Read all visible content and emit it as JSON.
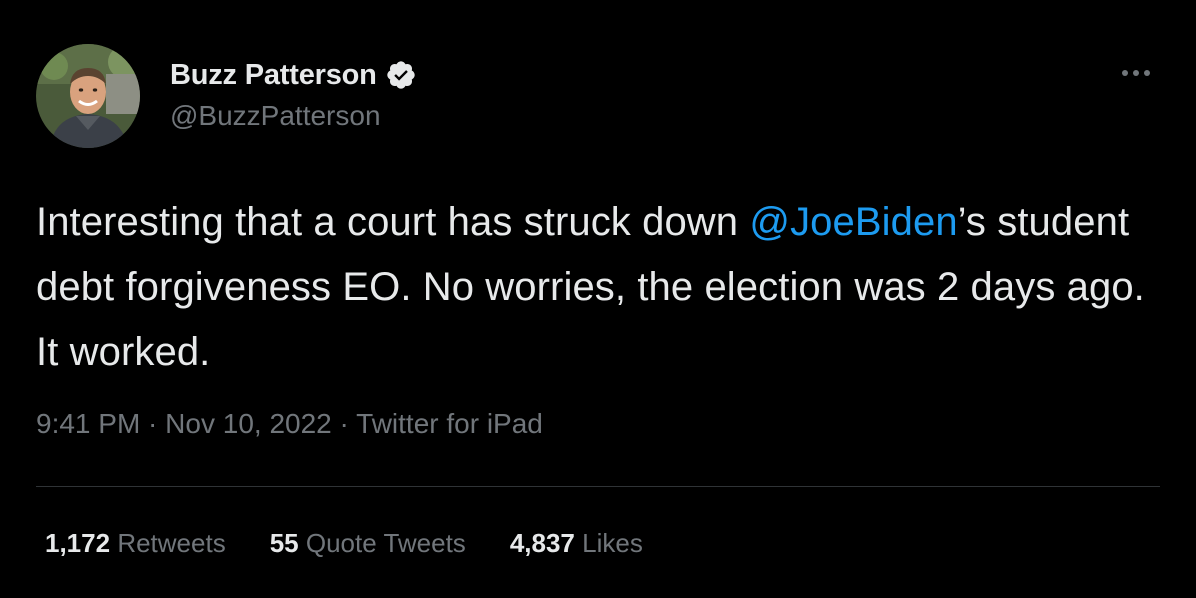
{
  "author": {
    "display_name": "Buzz Patterson",
    "handle": "@BuzzPatterson",
    "verified_icon": "verified-badge-icon"
  },
  "tweet": {
    "text_part1": "Interesting that a court has struck down ",
    "mention": "@JoeBiden",
    "text_part2": "’s student debt forgiveness EO. No worries, the election was 2 days ago. It worked."
  },
  "meta": {
    "time": "9:41 PM",
    "sep1": " · ",
    "date": "Nov 10, 2022",
    "sep2": " · ",
    "source": "Twitter for iPad"
  },
  "stats": {
    "retweets_count": "1,172",
    "retweets_label": "Retweets",
    "quotes_count": "55",
    "quotes_label": "Quote Tweets",
    "likes_count": "4,837",
    "likes_label": "Likes"
  },
  "colors": {
    "background": "#000000",
    "text": "#e7e9ea",
    "secondary": "#71767b",
    "accent": "#1d9bf0",
    "divider": "#2f3336"
  }
}
